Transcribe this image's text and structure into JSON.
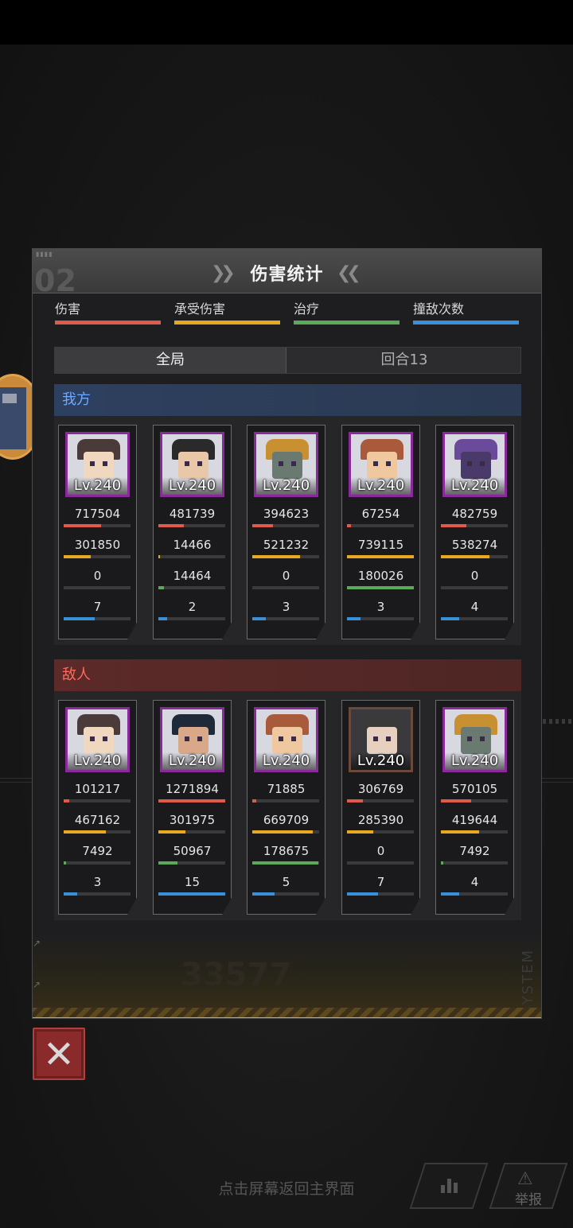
{
  "panel": {
    "title": "伤害统计",
    "deco_number": "02"
  },
  "legend": [
    {
      "label": "伤害",
      "color": "#e05a4a"
    },
    {
      "label": "承受伤害",
      "color": "#e8a820"
    },
    {
      "label": "治疗",
      "color": "#5aaa5a"
    },
    {
      "label": "撞敌次数",
      "color": "#3a90d8"
    }
  ],
  "tabs": {
    "all": "全局",
    "round": "回合13"
  },
  "sections": {
    "ours": {
      "title": "我方",
      "units": [
        {
          "level": "Lv.240",
          "damage": "717504",
          "damage_ratio": 0.56,
          "taken": "301850",
          "taken_ratio": 0.41,
          "heal": "0",
          "heal_ratio": 0.0,
          "hits": "7",
          "hits_ratio": 0.47,
          "hair": "#4a3a3a",
          "skin": "#f0d8c0"
        },
        {
          "level": "Lv.240",
          "damage": "481739",
          "damage_ratio": 0.38,
          "taken": "14466",
          "taken_ratio": 0.02,
          "heal": "14464",
          "heal_ratio": 0.08,
          "hits": "2",
          "hits_ratio": 0.13,
          "hair": "#2a2a2a",
          "skin": "#e8c8a8"
        },
        {
          "level": "Lv.240",
          "damage": "394623",
          "damage_ratio": 0.31,
          "taken": "521232",
          "taken_ratio": 0.71,
          "heal": "0",
          "heal_ratio": 0.0,
          "hits": "3",
          "hits_ratio": 0.2,
          "hair": "#c89030",
          "skin": "#6a7a70"
        },
        {
          "level": "Lv.240",
          "damage": "67254",
          "damage_ratio": 0.06,
          "taken": "739115",
          "taken_ratio": 1.0,
          "heal": "180026",
          "heal_ratio": 1.0,
          "hits": "3",
          "hits_ratio": 0.2,
          "hair": "#a85a3a",
          "skin": "#f0c8a0"
        },
        {
          "level": "Lv.240",
          "damage": "482759",
          "damage_ratio": 0.38,
          "taken": "538274",
          "taken_ratio": 0.73,
          "heal": "0",
          "heal_ratio": 0.0,
          "hits": "4",
          "hits_ratio": 0.27,
          "hair": "#6a4a9a",
          "skin": "#4a3a6a"
        }
      ]
    },
    "enemy": {
      "title": "敌人",
      "units": [
        {
          "level": "Lv.240",
          "damage": "101217",
          "damage_ratio": 0.08,
          "taken": "467162",
          "taken_ratio": 0.63,
          "heal": "7492",
          "heal_ratio": 0.04,
          "hits": "3",
          "hits_ratio": 0.2,
          "hair": "#4a3a3a",
          "skin": "#f0d8c0"
        },
        {
          "level": "Lv.240",
          "damage": "1271894",
          "damage_ratio": 1.0,
          "taken": "301975",
          "taken_ratio": 0.41,
          "heal": "50967",
          "heal_ratio": 0.28,
          "hits": "15",
          "hits_ratio": 1.0,
          "hair": "#1e2a3a",
          "skin": "#d8a888"
        },
        {
          "level": "Lv.240",
          "damage": "71885",
          "damage_ratio": 0.06,
          "taken": "669709",
          "taken_ratio": 0.91,
          "heal": "178675",
          "heal_ratio": 0.99,
          "hits": "5",
          "hits_ratio": 0.33,
          "hair": "#a85a3a",
          "skin": "#f0c8a0"
        },
        {
          "level": "Lv.240",
          "damage": "306769",
          "damage_ratio": 0.24,
          "taken": "285390",
          "taken_ratio": 0.39,
          "heal": "0",
          "heal_ratio": 0.0,
          "hits": "7",
          "hits_ratio": 0.47,
          "hair": "#3a3a3a",
          "skin": "#e8d0c0"
        },
        {
          "level": "Lv.240",
          "damage": "570105",
          "damage_ratio": 0.45,
          "taken": "419644",
          "taken_ratio": 0.57,
          "heal": "7492",
          "heal_ratio": 0.04,
          "hits": "4",
          "hits_ratio": 0.27,
          "hair": "#c89030",
          "skin": "#6a7a70"
        }
      ]
    }
  },
  "bottom": {
    "ghost_number": "33577",
    "system_text": "SYSTEM"
  },
  "footer": {
    "return_hint": "点击屏幕返回主界面",
    "report_label": "举报"
  },
  "icons": {
    "close": "close-icon",
    "stats": "bar-chart-icon",
    "warning": "warning-icon"
  }
}
